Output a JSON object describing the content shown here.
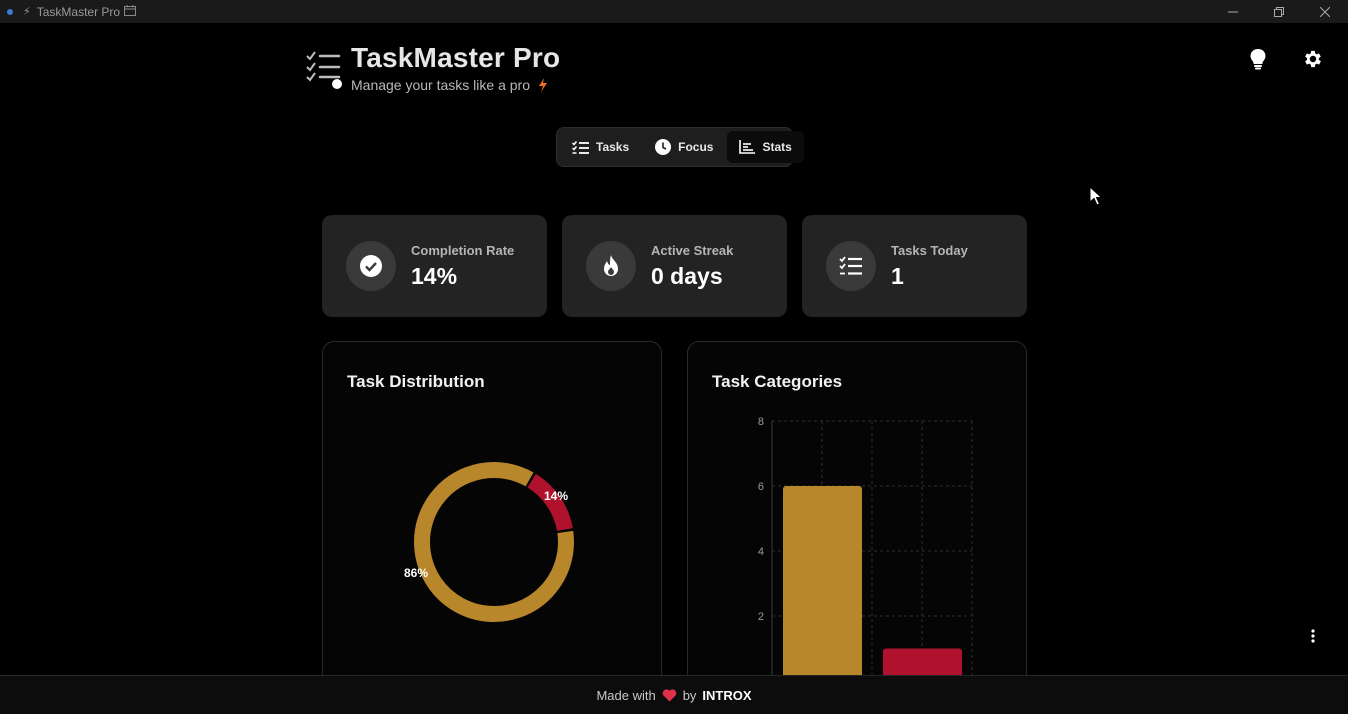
{
  "window": {
    "title": "TaskMaster Pro",
    "controls": [
      "minimize",
      "restore",
      "close"
    ]
  },
  "header": {
    "title": "TaskMaster Pro",
    "subtitle": "Manage your tasks like a pro"
  },
  "tabs": [
    {
      "label": "Tasks",
      "icon": "checklist-icon",
      "active": false
    },
    {
      "label": "Focus",
      "icon": "clock-icon",
      "active": false
    },
    {
      "label": "Stats",
      "icon": "chart-icon",
      "active": true
    }
  ],
  "stats": [
    {
      "label": "Completion Rate",
      "value": "14%",
      "icon": "check-circle-icon"
    },
    {
      "label": "Active Streak",
      "value": "0 days",
      "icon": "fire-icon"
    },
    {
      "label": "Tasks Today",
      "value": "1",
      "icon": "checklist-icon"
    }
  ],
  "cards": {
    "distribution_title": "Task Distribution",
    "categories_title": "Task Categories"
  },
  "chart_data": [
    {
      "type": "pie",
      "variant": "donut",
      "title": "Task Distribution",
      "slices": [
        {
          "label": "86%",
          "value": 86,
          "color": "#b8862b"
        },
        {
          "label": "14%",
          "value": 14,
          "color": "#b0122e"
        }
      ]
    },
    {
      "type": "bar",
      "title": "Task Categories",
      "values": [
        6,
        1
      ],
      "colors": [
        "#b8862b",
        "#b0122e"
      ],
      "ylim": [
        0,
        8
      ],
      "yticks": [
        "2",
        "4",
        "6",
        "8"
      ],
      "grid": true
    }
  ],
  "footer": {
    "made_with": "Made with",
    "by": "by",
    "author": "INTROX"
  },
  "colors": {
    "accent_gold": "#b8862b",
    "accent_red": "#b0122e",
    "bolt_orange": "#f0702a"
  }
}
